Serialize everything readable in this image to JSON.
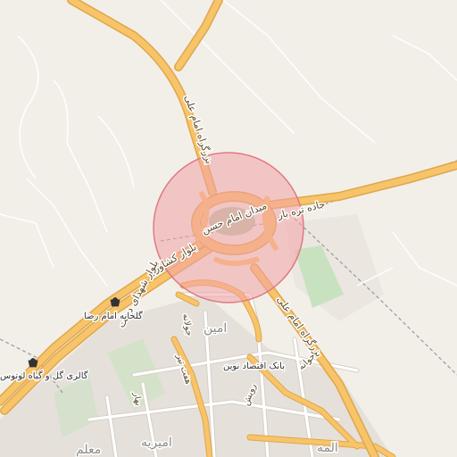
{
  "map": {
    "colors": {
      "land": "#f2efe9",
      "residential": "#e5e0da",
      "green": "#c8e2c0",
      "major_road": "#f7c46a",
      "major_road_casing": "#e0a64a",
      "minor_road": "#ffffff",
      "minor_casing": "#d2ccc2",
      "track": "#ffffff",
      "railway": "#9a9a9a",
      "highlight_fill": "#f2a3a8",
      "highlight_stroke": "#e07a83"
    },
    "roads": {
      "imam_ali_north": "بزرگراه امام علی",
      "imam_ali_south": "بزرگراه امام علی",
      "jadeh_tareh_bar": "جاده تره بار",
      "bolvar_keshavarz": "بلوار کشاورز",
      "meydan_imam_hasan": "میدان امام حسن",
      "bolvar_shohadaye_dolat": "بلوار شهدای دولت",
      "jolfa_1": "جولانه",
      "jolfa_2": "جوانه",
      "haft_tir": "هفت تیر",
      "rooyesh": "رویش",
      "bahar": "بهار"
    },
    "pois": {
      "golkhaneh": {
        "label": "گلخانه امام رضا",
        "icon": "shop-basket-icon"
      },
      "gallery": {
        "label": "گالری گل و گیاه لوتوس",
        "icon": "shop-basket-icon"
      },
      "bank": {
        "label": "بانک اقتصاد نوین",
        "icon": "bank-icon"
      }
    },
    "areas": {
      "amin": "امین",
      "amirieh": "امیریه",
      "moallem": "معلم",
      "alameh": "المه"
    }
  }
}
